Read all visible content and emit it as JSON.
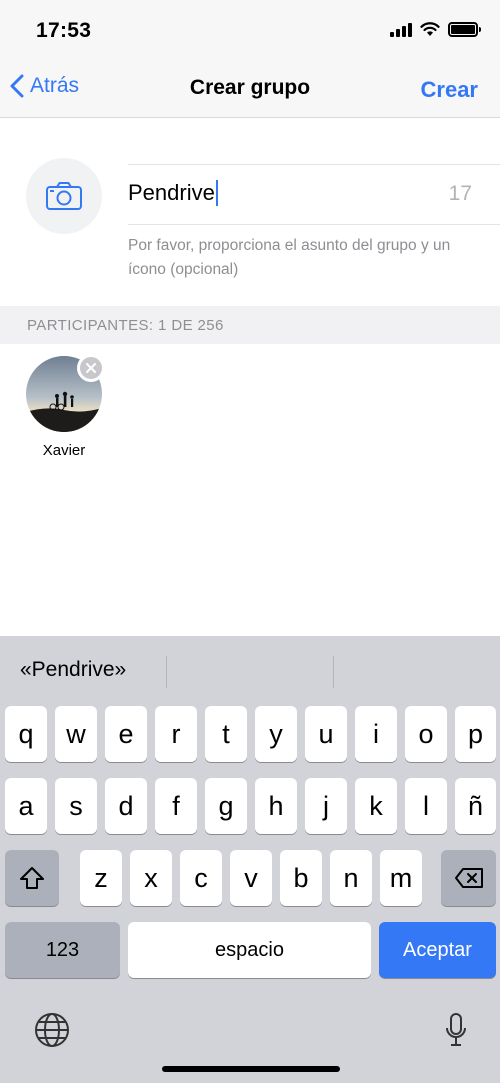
{
  "status_bar": {
    "time": "17:53"
  },
  "nav": {
    "back_label": "Atrás",
    "title": "Crear grupo",
    "create_label": "Crear",
    "accent_color": "#3478f6"
  },
  "group": {
    "subject_value": "Pendrive",
    "remaining_chars": "17",
    "hint": "Por favor, proporciona el asunto del grupo y un ícono (opcional)",
    "photo_icon": "camera-icon"
  },
  "participants": {
    "header": "PARTICIPANTES: 1 DE 256",
    "items": [
      {
        "name": "Xavier",
        "avatar": "photo-silhouettes-sunset"
      }
    ]
  },
  "keyboard": {
    "suggestion": "«Pendrive»",
    "row1": [
      "q",
      "w",
      "e",
      "r",
      "t",
      "y",
      "u",
      "i",
      "o",
      "p"
    ],
    "row2": [
      "a",
      "s",
      "d",
      "f",
      "g",
      "h",
      "j",
      "k",
      "l",
      "ñ"
    ],
    "row3": [
      "z",
      "x",
      "c",
      "v",
      "b",
      "n",
      "m"
    ],
    "numbers_label": "123",
    "space_label": "espacio",
    "return_label": "Aceptar",
    "icons": [
      "shift-icon",
      "backspace-icon",
      "globe-icon",
      "microphone-icon"
    ]
  }
}
